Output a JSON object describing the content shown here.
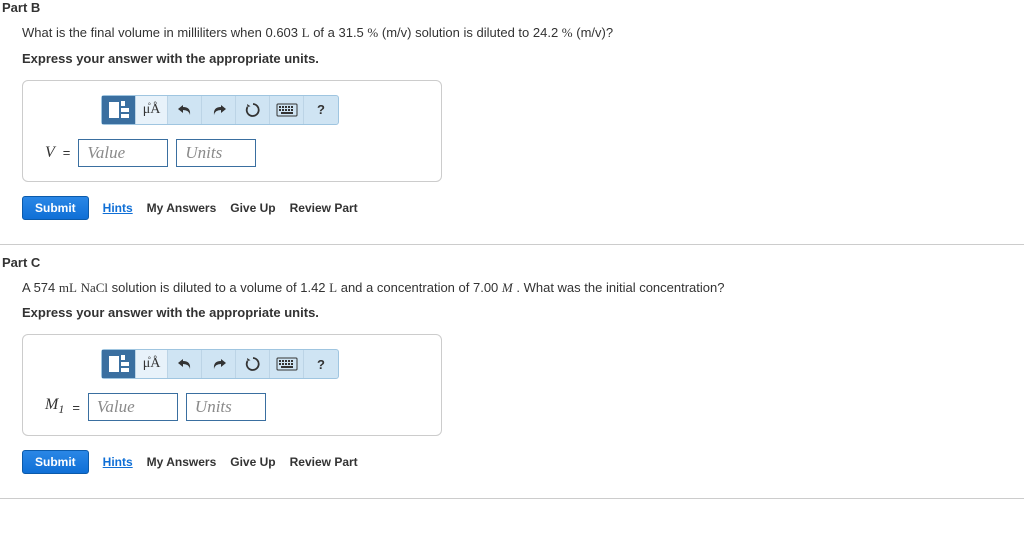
{
  "partB": {
    "header": "Part B",
    "question_pre": "What is the final volume in milliliters when 0.603 ",
    "q_L": "L",
    "q_mid1": " of a 31.5 ",
    "q_pct": "%",
    "q_mid2": " (m/v) solution is diluted to 24.2 ",
    "q_pct2": "%",
    "q_tail": " (m/v)?",
    "instruction": "Express your answer with the appropriate units.",
    "var_label_v": "V",
    "eq": "=",
    "value_ph": "Value",
    "units_ph": "Units",
    "toolbar": {
      "special": "μÅ",
      "help": "?"
    },
    "actions": {
      "submit": "Submit",
      "hints": "Hints",
      "my_answers": "My Answers",
      "give_up": "Give Up",
      "review": "Review Part"
    }
  },
  "partC": {
    "header": "Part C",
    "q_pre": "A 574 ",
    "q_mL": "mL",
    "q_mid1": " ",
    "q_nacl": "NaCl",
    "q_mid2": " solution is diluted to a volume of 1.42 ",
    "q_L": "L",
    "q_mid3": " and a concentration of 7.00 ",
    "q_M": "M",
    "q_tail": " . What was the initial concentration?",
    "instruction": "Express your answer with the appropriate units.",
    "var_label_m": "M",
    "var_sub": "1",
    "eq": "=",
    "value_ph": "Value",
    "units_ph": "Units",
    "toolbar": {
      "special": "μÅ",
      "help": "?"
    },
    "actions": {
      "submit": "Submit",
      "hints": "Hints",
      "my_answers": "My Answers",
      "give_up": "Give Up",
      "review": "Review Part"
    }
  }
}
